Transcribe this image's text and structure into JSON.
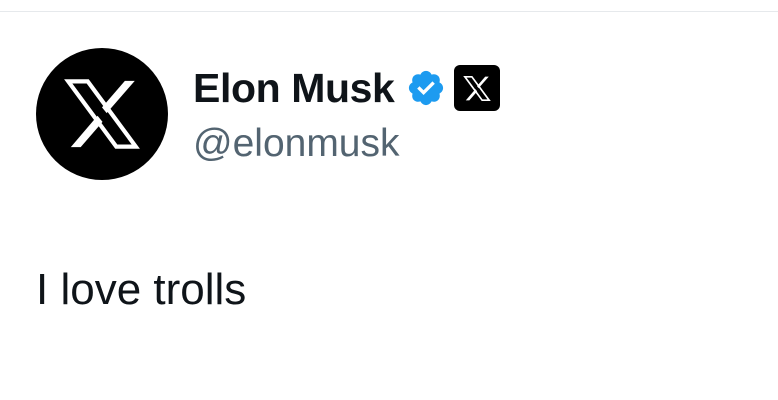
{
  "tweet": {
    "author": {
      "display_name": "Elon Musk",
      "handle": "@elonmusk",
      "avatar_icon": "x-logo-icon",
      "verified_badge_icon": "verified-badge-icon",
      "verified_color": "#1d9bf0",
      "affiliate_badge_icon": "x-logo-icon"
    },
    "text": "I love trolls"
  },
  "colors": {
    "text_primary": "#0f1419",
    "text_secondary": "#536471",
    "background": "#ffffff",
    "avatar_background": "#000000"
  }
}
